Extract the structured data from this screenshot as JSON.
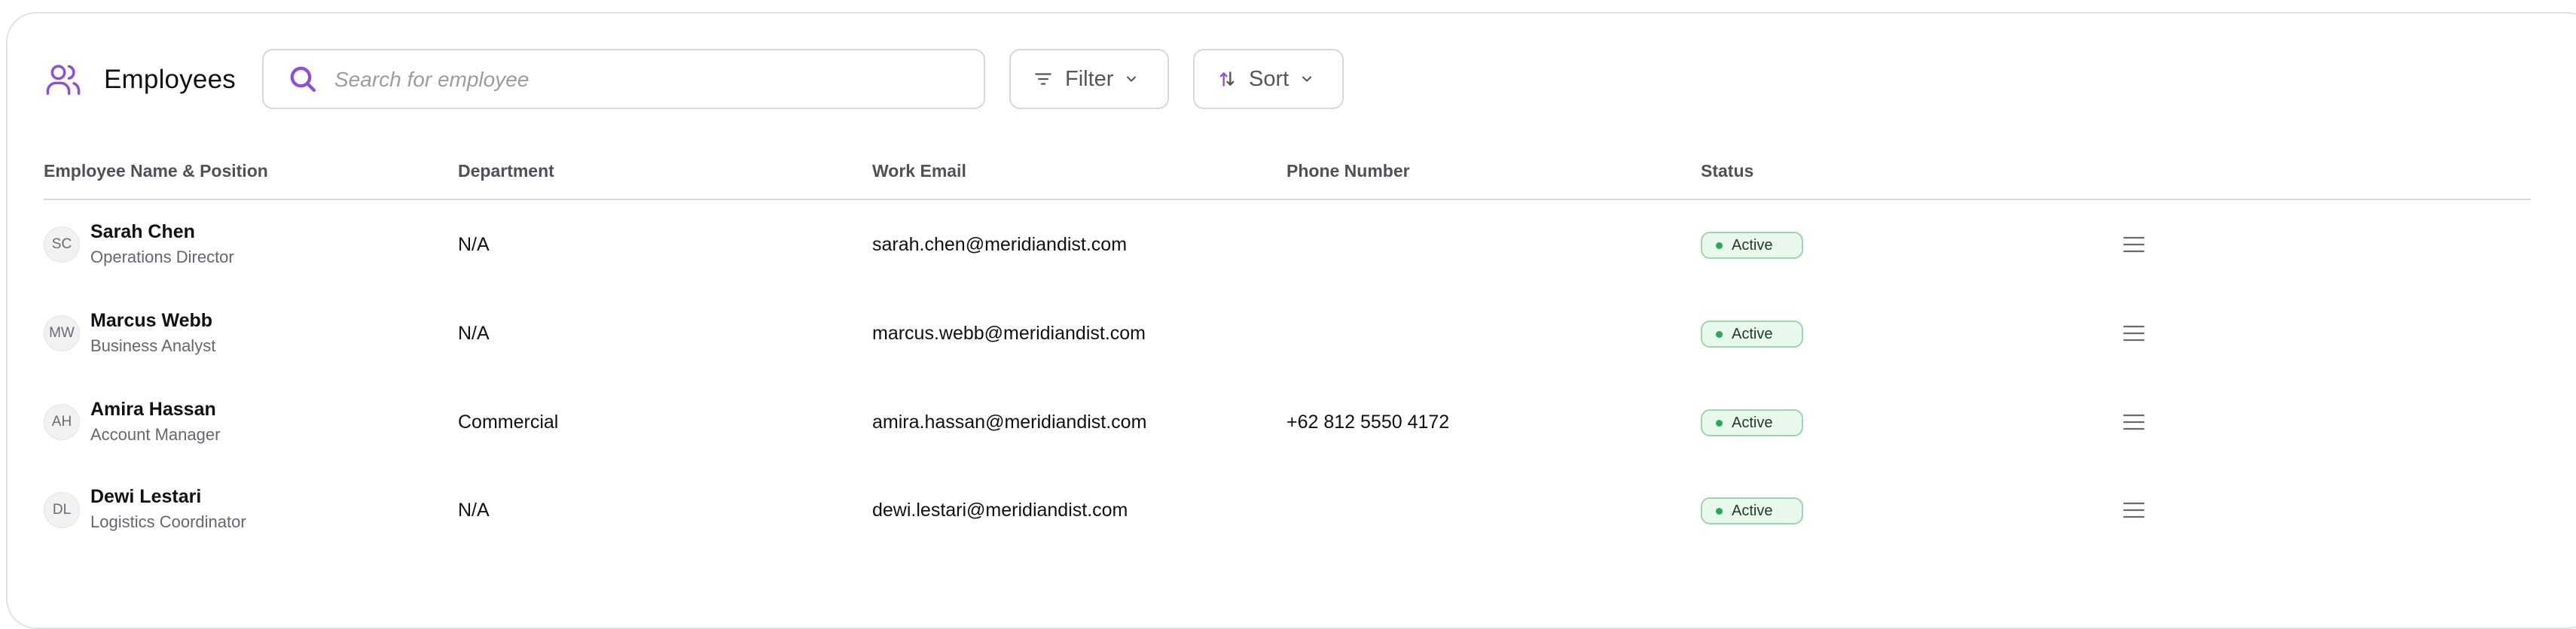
{
  "header": {
    "title": "Employees",
    "icon": "users-icon"
  },
  "search": {
    "placeholder": "Search for employee",
    "value": "",
    "icon": "search-icon",
    "icon_color": "#8b4fd8"
  },
  "toolbar": {
    "filter_label": "Filter",
    "sort_label": "Sort"
  },
  "table": {
    "columns": [
      "Employee Name & Position",
      "Department",
      "Work Email",
      "Phone Number",
      "Status"
    ],
    "rows": [
      {
        "initials": "SC",
        "name": "Sarah Chen",
        "position": "Operations Director",
        "department": "N/A",
        "email": "sarah.chen@meridiandist.com",
        "phone": "",
        "status": "Active"
      },
      {
        "initials": "MW",
        "name": "Marcus Webb",
        "position": "Business Analyst",
        "department": "N/A",
        "email": "marcus.webb@meridiandist.com",
        "phone": "",
        "status": "Active"
      },
      {
        "initials": "AH",
        "name": "Amira Hassan",
        "position": "Account Manager",
        "department": "Commercial",
        "email": "amira.hassan@meridiandist.com",
        "phone": "+62 812 5550 4172",
        "status": "Active"
      },
      {
        "initials": "DL",
        "name": "Dewi Lestari",
        "position": "Logistics Coordinator",
        "department": "N/A",
        "email": "dewi.lestari@meridiandist.com",
        "phone": "",
        "status": "Active"
      }
    ]
  },
  "colors": {
    "accent": "#8b4fd8",
    "status_active": "#2aa955",
    "border": "#d7d7dc"
  }
}
